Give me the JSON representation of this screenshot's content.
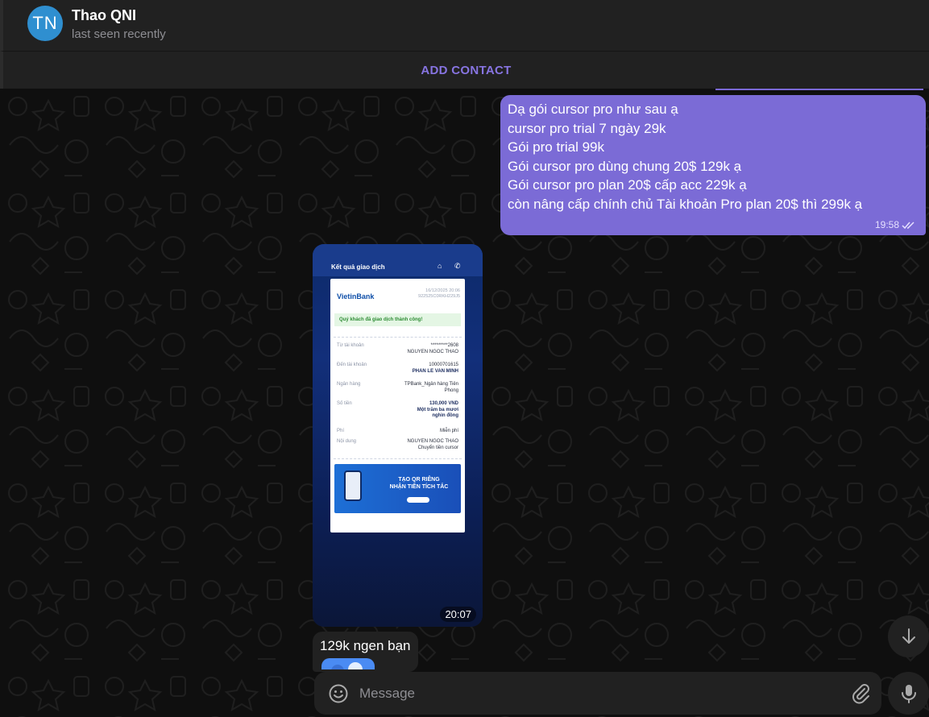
{
  "header": {
    "avatar_initials": "TN",
    "avatar_color": "#2f8fd0",
    "name": "Thao QNI",
    "status": "last seen recently"
  },
  "add_contact": {
    "label": "ADD CONTACT"
  },
  "messages": {
    "outgoing": {
      "lines": [
        "Dạ gói cursor pro như sau ạ",
        "cursor pro trial 7 ngày 29k",
        "Gói pro trial 99k",
        "Gói cursor pro dùng chung 20$ 129k ạ",
        "Gói cursor pro plan 20$ cấp acc  229k ạ",
        "còn nâng cấp chính chủ Tài khoản Pro plan 20$ thì 299k ạ"
      ],
      "time": "19:58",
      "status_icon": "double-check-icon"
    },
    "photo": {
      "time": "20:07",
      "receipt": {
        "header_title": "Kết quả giao dịch",
        "bank_logo": "VietinBank",
        "date": "16/12/2025 20:06",
        "ref": "922525C0RKH229J5",
        "success": "Quý khách đã giao dịch thành công!",
        "rows": [
          {
            "label": "Từ tài khoản",
            "value": "*********2608",
            "value2": "NGUYEN NGOC THAO"
          },
          {
            "label": "Đến tài khoản",
            "value": "10000701615",
            "value2": "PHAN LE VAN MINH"
          },
          {
            "label": "Ngân hàng",
            "value": "TPBank_Ngân hàng Tiên",
            "value2": "Phong"
          },
          {
            "label": "Số tiền",
            "value": "130,000 VND",
            "value2": "Một trăm ba mươi",
            "value3": "nghìn đồng"
          },
          {
            "label": "Phí",
            "value": "Miễn phí"
          },
          {
            "label": "Nội dung",
            "value": "NGUYEN NGOC THAO",
            "value2": "Chuyển tiền cursor"
          }
        ],
        "banner_text_1": "TẠO QR RIÊNG",
        "banner_text_2": "NHẬN TIỀN TÍCH TẮC"
      }
    },
    "incoming": {
      "text": "129k ngen bạn"
    }
  },
  "composer": {
    "placeholder": "Message"
  },
  "colors": {
    "accent": "#8774e1",
    "outgoing_bubble": "#7b6bd6",
    "panel": "#212121",
    "chat_bg": "#0f0f0f"
  }
}
